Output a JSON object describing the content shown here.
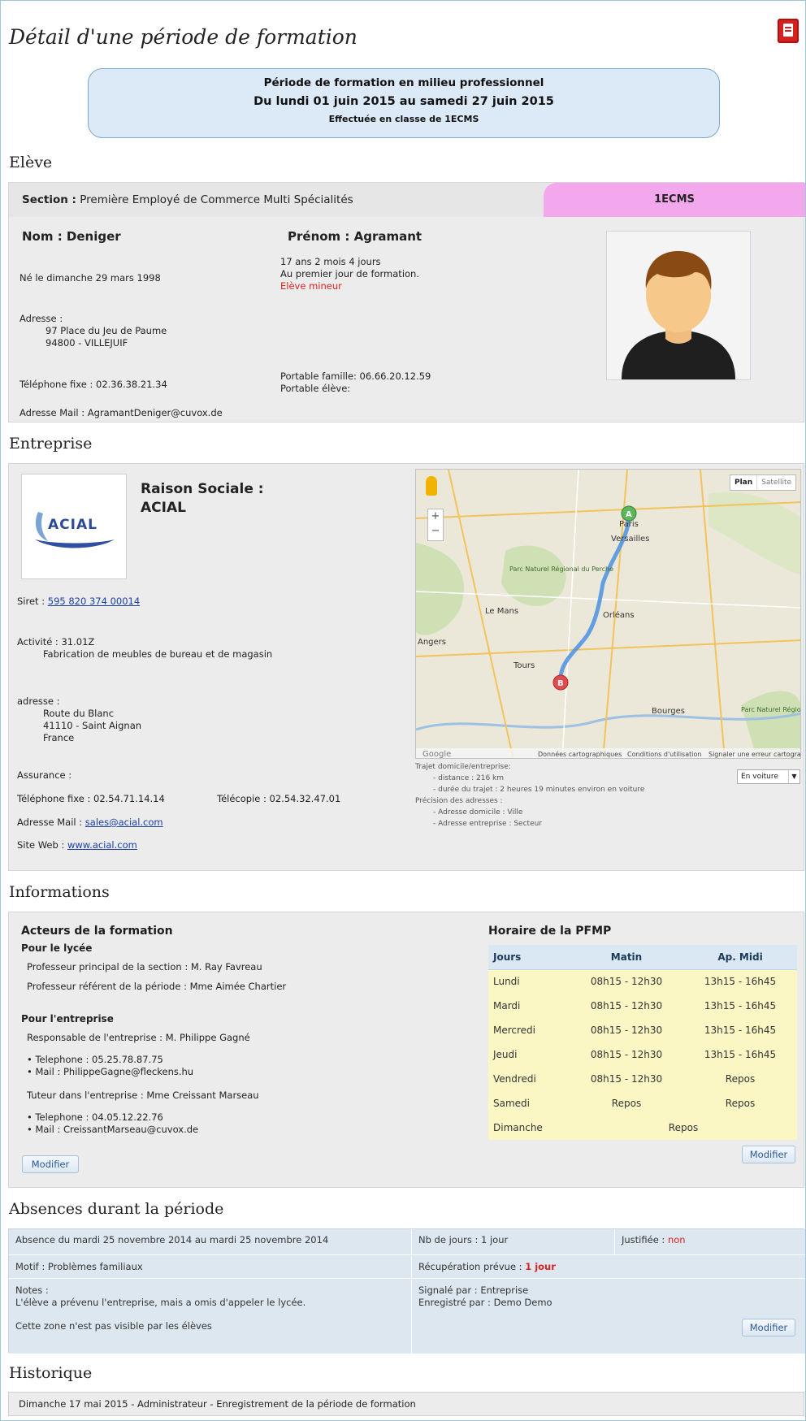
{
  "page": {
    "title": "Détail d'une période de formation",
    "pdf_icon": "pdf-icon",
    "banner": {
      "line1": "Période de formation en milieu professionnel",
      "line2": "Du lundi 01 juin 2015 au samedi 27 juin 2015",
      "line3": "Effectuée en classe de 1ECMS"
    }
  },
  "eleve": {
    "heading": "Elève",
    "section_label": "Section :",
    "section_value": "Première Employé de Commerce Multi Spécialités",
    "class_badge": "1ECMS",
    "nom": "Nom : Deniger",
    "prenom": "Prénom : Agramant",
    "naissance": "Né le dimanche 29 mars 1998",
    "age_line1": "17 ans 2 mois 4 jours",
    "age_line2": "Au premier jour de formation.",
    "mineur": "Elève mineur",
    "adresse_label": "Adresse :",
    "adresse_1": "97 Place du Jeu de Paume",
    "adresse_2": "94800 - VILLEJUIF",
    "tel_fixe": "Téléphone fixe : 02.36.38.21.34",
    "portable_famille": "Portable famille: 06.66.20.12.59",
    "portable_eleve": "Portable élève:",
    "mail": "Adresse Mail : AgramantDeniger@cuvox.de"
  },
  "entreprise": {
    "heading": "Entreprise",
    "logo_text": "ACIAL",
    "raison_label": "Raison Sociale :",
    "raison_value": "ACIAL",
    "siret_label": "Siret :",
    "siret_value": "595 820 374 00014",
    "activite_label": "Activité : 31.01Z",
    "activite_desc": "Fabrication de meubles de bureau et de magasin",
    "adresse_label": "adresse :",
    "adresse_1": "Route du Blanc",
    "adresse_2": "41110 - Saint Aignan",
    "adresse_3": "France",
    "assurance": "Assurance :",
    "tel_fixe": "Téléphone fixe : 02.54.71.14.14",
    "telecopie": "Télécopie : 02.54.32.47.01",
    "mail_label": "Adresse Mail :",
    "mail_value": "sales@acial.com",
    "web_label": "Site Web :",
    "web_value": "www.acial.com",
    "map": {
      "btn_plan": "Plan",
      "btn_satellite": "Satellite",
      "zoom_in": "+",
      "zoom_out": "−",
      "marker_a": "A",
      "marker_b": "B",
      "places": [
        "Paris",
        "Versailles",
        "Parc Naturel Régional du Perche",
        "Le Mans",
        "Orléans",
        "Tours",
        "Bourges",
        "Parc Naturel Régional du Morvan",
        "Angers"
      ],
      "footer": [
        "Google",
        "Données cartographiques",
        "Conditions d'utilisation",
        "Signaler une erreur cartographique"
      ],
      "route_title": "Trajet domicile/entreprise:",
      "distance": "- distance : 216 km",
      "duree": "- durée du trajet : 2 heures 19 minutes environ en voiture",
      "precision_title": "Précision des adresses :",
      "precision_domicile": "- Adresse domicile : Ville",
      "precision_entreprise": "- Adresse entreprise : Secteur",
      "mode_select": "En voiture"
    }
  },
  "informations": {
    "heading": "Informations",
    "acteurs_title": "Acteurs de la formation",
    "lycee_title": "Pour le lycée",
    "prof_principal": "Professeur principal de la section : M. Ray Favreau",
    "prof_referent": "Professeur référent de la période : Mme Aimée Chartier",
    "entreprise_title": "Pour l'entreprise",
    "responsable": "Responsable de l'entreprise : M. Philippe Gagné",
    "resp_tel": "Telephone : 05.25.78.87.75",
    "resp_mail": "Mail : PhilippeGagne@fleckens.hu",
    "tuteur": "Tuteur dans l'entreprise : Mme Creissant Marseau",
    "tuteur_tel": "Telephone : 04.05.12.22.76",
    "tuteur_mail": "Mail : CreissantMarseau@cuvox.de",
    "modifier_left": "Modifier",
    "horaire_title": "Horaire de la PFMP",
    "table_headers": [
      "Jours",
      "Matin",
      "Ap. Midi"
    ],
    "rows": [
      {
        "jour": "Lundi",
        "matin": "08h15 - 12h30",
        "apm": "13h15 - 16h45"
      },
      {
        "jour": "Mardi",
        "matin": "08h15 - 12h30",
        "apm": "13h15 - 16h45"
      },
      {
        "jour": "Mercredi",
        "matin": "08h15 - 12h30",
        "apm": "13h15 - 16h45"
      },
      {
        "jour": "Jeudi",
        "matin": "08h15 - 12h30",
        "apm": "13h15 - 16h45"
      },
      {
        "jour": "Vendredi",
        "matin": "08h15 - 12h30",
        "apm": "Repos"
      },
      {
        "jour": "Samedi",
        "matin": "Repos",
        "apm": "Repos"
      },
      {
        "jour": "Dimanche",
        "full": "Repos"
      }
    ],
    "modifier_right": "Modifier"
  },
  "absences": {
    "heading": "Absences durant la période",
    "periode": "Absence du mardi 25 novembre 2014 au mardi 25 novembre 2014",
    "nb_jours": "Nb de jours : 1 jour",
    "justifiee_label": "Justifiée :",
    "justifiee_value": "non",
    "motif": "Motif : Problèmes familiaux",
    "recup_label": "Récupération prévue :",
    "recup_value": "1 jour",
    "notes_label": "Notes :",
    "notes_text": "L'élève a prévenu l'entreprise, mais a omis d'appeler le lycée.",
    "signale": "Signalé par : Entreprise",
    "enregistre": "Enregistré par : Demo Demo",
    "visibility": "Cette zone n'est pas visible par les élèves",
    "modifier": "Modifier"
  },
  "historique": {
    "heading": "Historique",
    "entry": "Dimanche 17 mai 2015 - Administrateur - Enregistrement de la période de formation"
  }
}
